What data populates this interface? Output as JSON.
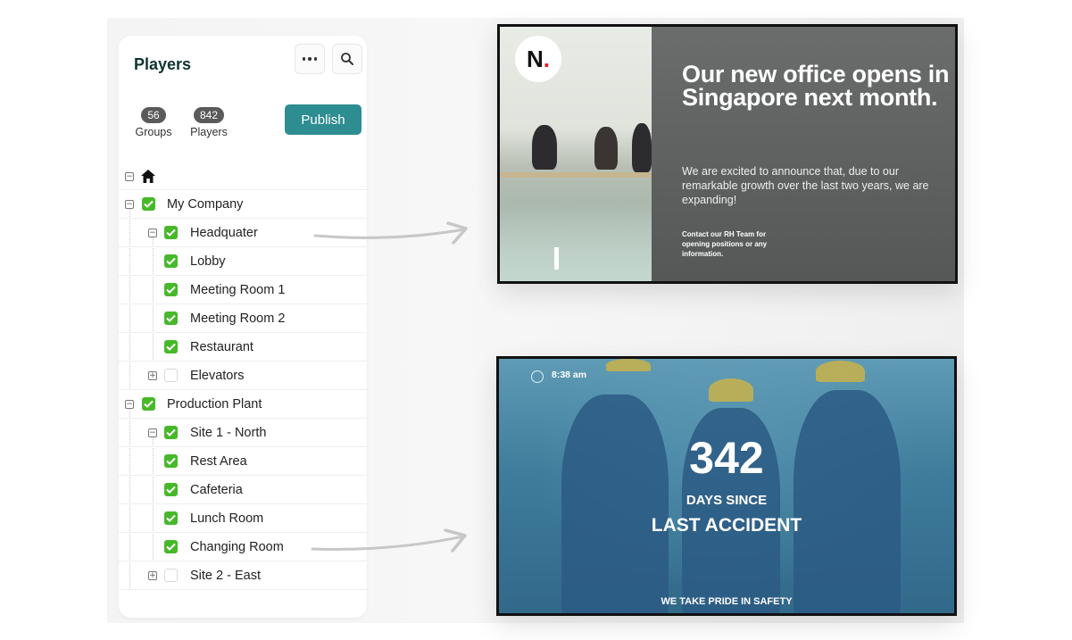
{
  "panel": {
    "title": "Players",
    "more_icon": "ellipsis-icon",
    "search_icon": "magnifier-icon",
    "stats": {
      "groups_count": "56",
      "groups_label": "Groups",
      "players_count": "842",
      "players_label": "Players"
    },
    "publish_label": "Publish",
    "accent_color": "#2e8d91",
    "check_color": "#47b82a"
  },
  "tree": {
    "root_icon": "home-icon",
    "items": [
      {
        "label": "My Company",
        "level": 0,
        "expanded": true,
        "checked": true
      },
      {
        "label": "Headquater",
        "level": 1,
        "expanded": true,
        "checked": true
      },
      {
        "label": "Lobby",
        "level": 1,
        "checked": true
      },
      {
        "label": "Meeting Room 1",
        "level": 1,
        "checked": true
      },
      {
        "label": "Meeting Room 2",
        "level": 1,
        "checked": true
      },
      {
        "label": "Restaurant",
        "level": 1,
        "checked": true
      },
      {
        "label": "Elevators",
        "level": 1,
        "expanded": false,
        "checked": false
      },
      {
        "label": "Production Plant",
        "level": 0,
        "expanded": true,
        "checked": true
      },
      {
        "label": "Site 1 - North",
        "level": 1,
        "expanded": true,
        "checked": true
      },
      {
        "label": "Rest Area",
        "level": 1,
        "checked": true
      },
      {
        "label": "Cafeteria",
        "level": 1,
        "checked": true
      },
      {
        "label": "Lunch Room",
        "level": 1,
        "checked": true
      },
      {
        "label": "Changing Room",
        "level": 1,
        "checked": true
      },
      {
        "label": "Site 2 - East",
        "level": 1,
        "expanded": false,
        "checked": false
      }
    ]
  },
  "screen_office": {
    "logo_letter": "N",
    "logo_dot": ".",
    "headline": "Our new office opens in Singapore next month.",
    "body": "We are excited to announce that, due to our remarkable growth over the last two years, we are expanding!",
    "contact": "Contact our RH Team for opening positions or any information."
  },
  "screen_safety": {
    "time": "8:38 am",
    "days_count": "342",
    "days_since": "DAYS SINCE",
    "last_accident": "LAST ACCIDENT",
    "tagline": "WE TAKE PRIDE IN SAFETY"
  }
}
